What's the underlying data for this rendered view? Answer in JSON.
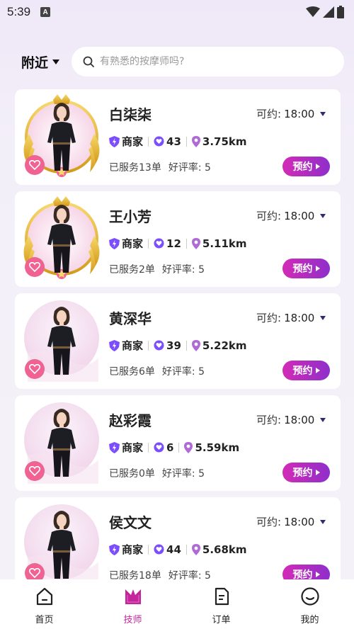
{
  "status": {
    "time": "5:39",
    "a_badge": "A"
  },
  "header": {
    "location": "附近",
    "search_placeholder": "有熟悉的按摩师吗?"
  },
  "colors": {
    "accent": "#c3269a",
    "button_from": "#d22bb5",
    "button_to": "#8e2fcb",
    "fav": "#f06292",
    "merchant_icon": "#7c4dff"
  },
  "therapists": [
    {
      "name": "白柒柒",
      "avail_label": "可约:",
      "avail_time": "18:00",
      "merchant": "商家",
      "score": "43",
      "distance": "3.75km",
      "served": "已服务13单",
      "rating": "好评率: 5",
      "book": "预约",
      "frame": "gold"
    },
    {
      "name": "王小芳",
      "avail_label": "可约:",
      "avail_time": "18:00",
      "merchant": "商家",
      "score": "12",
      "distance": "5.11km",
      "served": "已服务2单",
      "rating": "好评率: 5",
      "book": "预约",
      "frame": "gold"
    },
    {
      "name": "黄深华",
      "avail_label": "可约:",
      "avail_time": "18:00",
      "merchant": "商家",
      "score": "39",
      "distance": "5.22km",
      "served": "已服务6单",
      "rating": "好评率: 5",
      "book": "预约",
      "frame": "plain"
    },
    {
      "name": "赵彩霞",
      "avail_label": "可约:",
      "avail_time": "18:00",
      "merchant": "商家",
      "score": "6",
      "distance": "5.59km",
      "served": "已服务0单",
      "rating": "好评率: 5",
      "book": "预约",
      "frame": "plain"
    },
    {
      "name": "侯文文",
      "avail_label": "可约:",
      "avail_time": "18:00",
      "merchant": "商家",
      "score": "44",
      "distance": "5.68km",
      "served": "已服务18单",
      "rating": "好评率: 5",
      "book": "预约",
      "frame": "plain"
    }
  ],
  "tabs": [
    {
      "label": "首页",
      "icon": "home-icon",
      "active": false
    },
    {
      "label": "技师",
      "icon": "therapist-icon",
      "active": true
    },
    {
      "label": "订单",
      "icon": "order-icon",
      "active": false
    },
    {
      "label": "我的",
      "icon": "profile-icon",
      "active": false
    }
  ]
}
